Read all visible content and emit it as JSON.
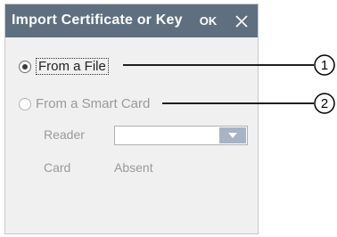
{
  "dialog": {
    "title": "Import Certificate or Key",
    "ok_label": "OK",
    "close_icon": "close-icon"
  },
  "options": {
    "from_file": {
      "label": "From a File",
      "selected": true,
      "enabled": true
    },
    "from_smart_card": {
      "label": "From a Smart Card",
      "selected": false,
      "enabled": false
    }
  },
  "reader": {
    "label": "Reader",
    "value": "",
    "icon": "chevron-down-icon"
  },
  "card": {
    "label": "Card",
    "value": "Absent"
  },
  "callouts": [
    "1",
    "2"
  ],
  "colors": {
    "titlebar": "#5f6f80",
    "dialog_bg": "#f0f0f0",
    "disabled_text": "#9a9a9a",
    "dropdown_button": "#a7b4c4"
  }
}
